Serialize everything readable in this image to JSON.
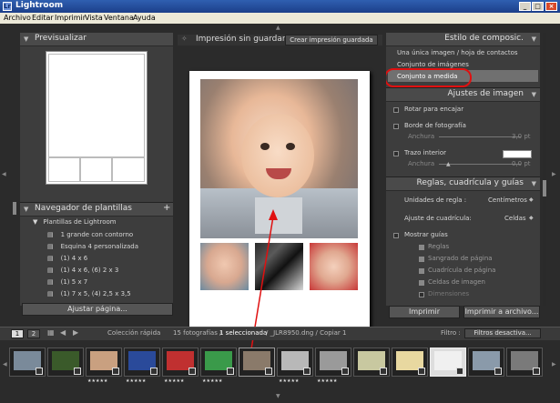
{
  "window": {
    "title": "Lightroom",
    "minimize": "_",
    "maximize": "□",
    "close": "×"
  },
  "menu": [
    "Archivo",
    "Editar",
    "Imprimir",
    "Vista",
    "Ventana",
    "Ayuda"
  ],
  "left_panel": {
    "preview_header": "Previsualizar",
    "navigator_header": "Navegador de plantillas",
    "navigator_add": "+",
    "templates_group": "Plantillas de Lightroom",
    "templates": [
      "1 grande con contorno",
      "Esquina 4 personalizada",
      "(1) 4 x 6",
      "(1) 4 x 6, (6) 2 x 3",
      "(1) 5 x 7",
      "(1) 7 x 5, (4) 2,5 x 3,5"
    ],
    "adjust_page_button": "Ajustar página..."
  },
  "center": {
    "title": "Impresión sin guardar",
    "create_print_button": "Crear impresión guardada"
  },
  "right_panel": {
    "layout_style_header": "Estilo de composic.",
    "layout_options": [
      "Una única imagen / hoja de contactos",
      "Conjunto de imágenes",
      "Conjunto a medida"
    ],
    "selected_layout_index": 2,
    "image_settings_header": "Ajustes de imagen",
    "rotate_to_fit": "Rotar para encajar",
    "photo_border": "Borde de fotografía",
    "photo_border_width_label": "Anchura",
    "photo_border_width_value": "3,0 pt",
    "inner_stroke": "Trazo interior",
    "inner_stroke_width_label": "Anchura",
    "inner_stroke_width_value": "0,0 pt",
    "rulers_header": "Reglas, cuadrícula y guías",
    "ruler_units_label": "Unidades de regla :",
    "ruler_units_value": "Centímetros",
    "grid_snap_label": "Ajuste de cuadrícula:",
    "grid_snap_value": "Celdas",
    "show_guides": "Mostrar guías",
    "guides": [
      "Reglas",
      "Sangrado de página",
      "Cuadrícula de página",
      "Celdas de imagen",
      "Dimensiones"
    ],
    "guides_checked": [
      true,
      true,
      true,
      true,
      false
    ],
    "print_button": "Imprimir",
    "print_to_file_button": "Imprimir a archivo..."
  },
  "filmstrip": {
    "screen1": "1",
    "screen2": "2",
    "source_label": "Colección rápida",
    "count_prefix": "15 fotografías /",
    "selected_text": "1 seleccionada",
    "file_text": "/ _JLR8950.dng / Copiar 1",
    "filter_label": "Filtro :",
    "filter_value": "Filtros desactiva...",
    "stars": "★★★★★",
    "thumb_colors": [
      "#7a8a9a",
      "#3a5a2a",
      "#c9a080",
      "#2a4a9a",
      "#c03030",
      "#3a9a4a",
      "#8a7a6a",
      "#b8b8b8",
      "#9a9a9a",
      "#c8c8a0",
      "#e8d8a0",
      "#f0f0f0",
      "#8a9aaa",
      "#7a7a7a"
    ]
  }
}
